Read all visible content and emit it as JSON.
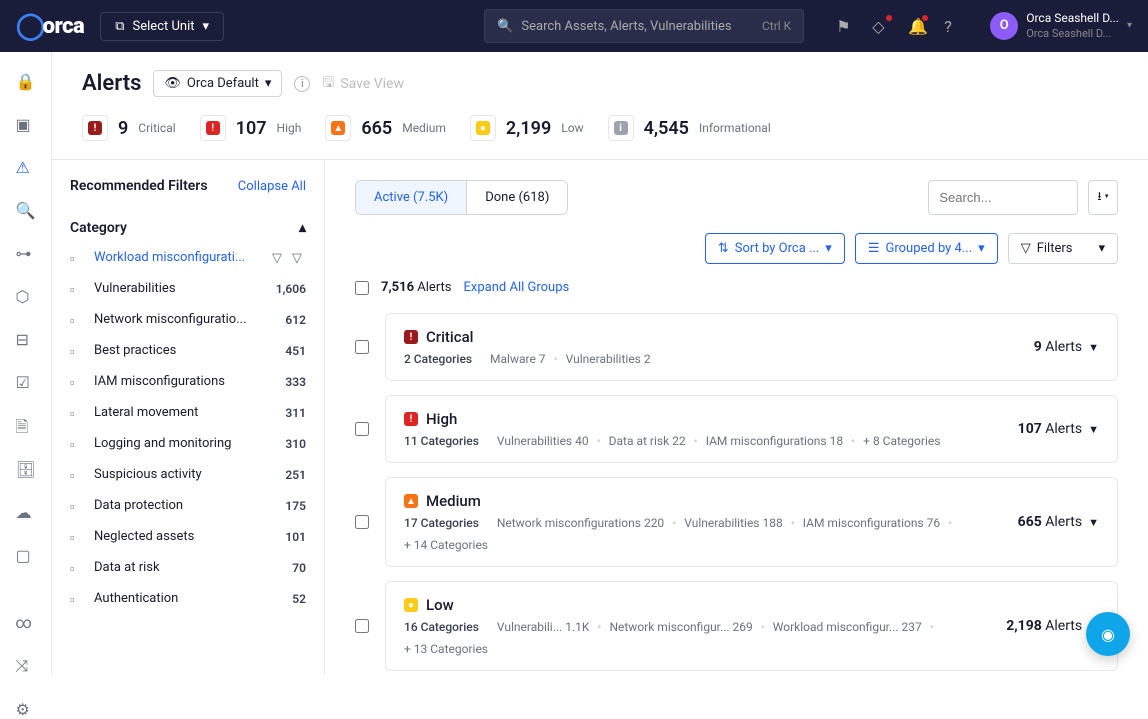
{
  "brand": "orca",
  "unit_selector": {
    "label": "Select Unit"
  },
  "global_search": {
    "placeholder": "Search Assets, Alerts, Vulnerabilities",
    "shortcut": "Ctrl K"
  },
  "user": {
    "initial": "O",
    "line1": "Orca Seashell D...",
    "line2": "Orca Seashell D..."
  },
  "page": {
    "title": "Alerts",
    "view": "Orca Default",
    "save_view": "Save View"
  },
  "stats": [
    {
      "count": "9",
      "label": "Critical",
      "sev": "critical"
    },
    {
      "count": "107",
      "label": "High",
      "sev": "high"
    },
    {
      "count": "665",
      "label": "Medium",
      "sev": "medium"
    },
    {
      "count": "2,199",
      "label": "Low",
      "sev": "low"
    },
    {
      "count": "4,545",
      "label": "Informational",
      "sev": "info"
    }
  ],
  "filters": {
    "title": "Recommended Filters",
    "collapse": "Collapse All",
    "section": "Category",
    "items": [
      {
        "label": "Workload misconfigurati...",
        "count": "",
        "active": true
      },
      {
        "label": "Vulnerabilities",
        "count": "1,606"
      },
      {
        "label": "Network misconfiguratio...",
        "count": "612"
      },
      {
        "label": "Best practices",
        "count": "451"
      },
      {
        "label": "IAM misconfigurations",
        "count": "333"
      },
      {
        "label": "Lateral movement",
        "count": "311"
      },
      {
        "label": "Logging and monitoring",
        "count": "310"
      },
      {
        "label": "Suspicious activity",
        "count": "251"
      },
      {
        "label": "Data protection",
        "count": "175"
      },
      {
        "label": "Neglected assets",
        "count": "101"
      },
      {
        "label": "Data at risk",
        "count": "70"
      },
      {
        "label": "Authentication",
        "count": "52"
      }
    ]
  },
  "alerts": {
    "tabs": {
      "active": "Active (7.5K)",
      "done": "Done (618)"
    },
    "search_placeholder": "Search...",
    "sort": "Sort by Orca ...",
    "group": "Grouped by 4...",
    "filters_btn": "Filters",
    "total": "7,516",
    "total_label": "Alerts",
    "expand": "Expand All Groups",
    "groups": [
      {
        "sev": "critical",
        "title": "Critical",
        "cats": "2 Categories",
        "breakdown": [
          "Malware 7",
          "Vulnerabilities 2"
        ],
        "count": "9",
        "count_label": "Alerts"
      },
      {
        "sev": "high",
        "title": "High",
        "cats": "11 Categories",
        "breakdown": [
          "Vulnerabilities 40",
          "Data at risk 22",
          "IAM misconfigurations 18",
          "+ 8 Categories"
        ],
        "count": "107",
        "count_label": "Alerts"
      },
      {
        "sev": "medium",
        "title": "Medium",
        "cats": "17 Categories",
        "breakdown": [
          "Network misconfigurations 220",
          "Vulnerabilities 188",
          "IAM misconfigurations 76",
          "+ 14 Categories"
        ],
        "count": "665",
        "count_label": "Alerts"
      },
      {
        "sev": "low",
        "title": "Low",
        "cats": "16 Categories",
        "breakdown": [
          "Vulnerabili... 1.1K",
          "Network misconfigur... 269",
          "Workload misconfigur... 237",
          "+ 13 Categories"
        ],
        "count": "2,198",
        "count_label": "Alerts"
      }
    ]
  }
}
